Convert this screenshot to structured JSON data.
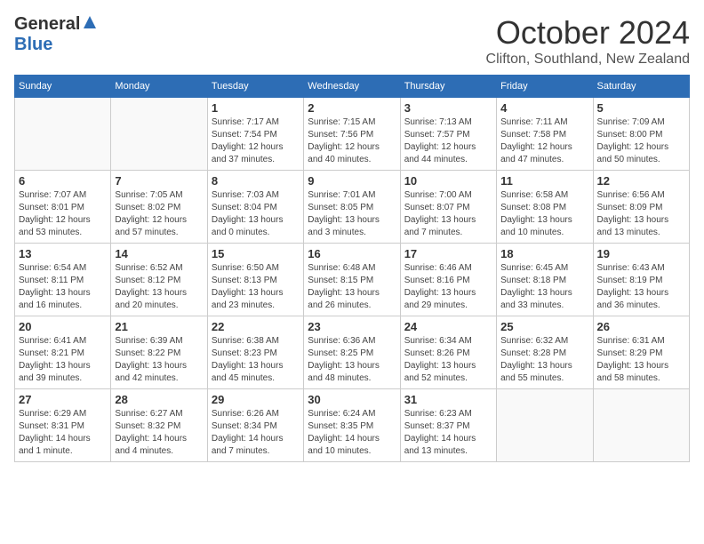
{
  "header": {
    "logo_general": "General",
    "logo_blue": "Blue",
    "month_title": "October 2024",
    "location": "Clifton, Southland, New Zealand"
  },
  "days_of_week": [
    "Sunday",
    "Monday",
    "Tuesday",
    "Wednesday",
    "Thursday",
    "Friday",
    "Saturday"
  ],
  "weeks": [
    [
      {
        "day": "",
        "info": ""
      },
      {
        "day": "",
        "info": ""
      },
      {
        "day": "1",
        "info": "Sunrise: 7:17 AM\nSunset: 7:54 PM\nDaylight: 12 hours and 37 minutes."
      },
      {
        "day": "2",
        "info": "Sunrise: 7:15 AM\nSunset: 7:56 PM\nDaylight: 12 hours and 40 minutes."
      },
      {
        "day": "3",
        "info": "Sunrise: 7:13 AM\nSunset: 7:57 PM\nDaylight: 12 hours and 44 minutes."
      },
      {
        "day": "4",
        "info": "Sunrise: 7:11 AM\nSunset: 7:58 PM\nDaylight: 12 hours and 47 minutes."
      },
      {
        "day": "5",
        "info": "Sunrise: 7:09 AM\nSunset: 8:00 PM\nDaylight: 12 hours and 50 minutes."
      }
    ],
    [
      {
        "day": "6",
        "info": "Sunrise: 7:07 AM\nSunset: 8:01 PM\nDaylight: 12 hours and 53 minutes."
      },
      {
        "day": "7",
        "info": "Sunrise: 7:05 AM\nSunset: 8:02 PM\nDaylight: 12 hours and 57 minutes."
      },
      {
        "day": "8",
        "info": "Sunrise: 7:03 AM\nSunset: 8:04 PM\nDaylight: 13 hours and 0 minutes."
      },
      {
        "day": "9",
        "info": "Sunrise: 7:01 AM\nSunset: 8:05 PM\nDaylight: 13 hours and 3 minutes."
      },
      {
        "day": "10",
        "info": "Sunrise: 7:00 AM\nSunset: 8:07 PM\nDaylight: 13 hours and 7 minutes."
      },
      {
        "day": "11",
        "info": "Sunrise: 6:58 AM\nSunset: 8:08 PM\nDaylight: 13 hours and 10 minutes."
      },
      {
        "day": "12",
        "info": "Sunrise: 6:56 AM\nSunset: 8:09 PM\nDaylight: 13 hours and 13 minutes."
      }
    ],
    [
      {
        "day": "13",
        "info": "Sunrise: 6:54 AM\nSunset: 8:11 PM\nDaylight: 13 hours and 16 minutes."
      },
      {
        "day": "14",
        "info": "Sunrise: 6:52 AM\nSunset: 8:12 PM\nDaylight: 13 hours and 20 minutes."
      },
      {
        "day": "15",
        "info": "Sunrise: 6:50 AM\nSunset: 8:13 PM\nDaylight: 13 hours and 23 minutes."
      },
      {
        "day": "16",
        "info": "Sunrise: 6:48 AM\nSunset: 8:15 PM\nDaylight: 13 hours and 26 minutes."
      },
      {
        "day": "17",
        "info": "Sunrise: 6:46 AM\nSunset: 8:16 PM\nDaylight: 13 hours and 29 minutes."
      },
      {
        "day": "18",
        "info": "Sunrise: 6:45 AM\nSunset: 8:18 PM\nDaylight: 13 hours and 33 minutes."
      },
      {
        "day": "19",
        "info": "Sunrise: 6:43 AM\nSunset: 8:19 PM\nDaylight: 13 hours and 36 minutes."
      }
    ],
    [
      {
        "day": "20",
        "info": "Sunrise: 6:41 AM\nSunset: 8:21 PM\nDaylight: 13 hours and 39 minutes."
      },
      {
        "day": "21",
        "info": "Sunrise: 6:39 AM\nSunset: 8:22 PM\nDaylight: 13 hours and 42 minutes."
      },
      {
        "day": "22",
        "info": "Sunrise: 6:38 AM\nSunset: 8:23 PM\nDaylight: 13 hours and 45 minutes."
      },
      {
        "day": "23",
        "info": "Sunrise: 6:36 AM\nSunset: 8:25 PM\nDaylight: 13 hours and 48 minutes."
      },
      {
        "day": "24",
        "info": "Sunrise: 6:34 AM\nSunset: 8:26 PM\nDaylight: 13 hours and 52 minutes."
      },
      {
        "day": "25",
        "info": "Sunrise: 6:32 AM\nSunset: 8:28 PM\nDaylight: 13 hours and 55 minutes."
      },
      {
        "day": "26",
        "info": "Sunrise: 6:31 AM\nSunset: 8:29 PM\nDaylight: 13 hours and 58 minutes."
      }
    ],
    [
      {
        "day": "27",
        "info": "Sunrise: 6:29 AM\nSunset: 8:31 PM\nDaylight: 14 hours and 1 minute."
      },
      {
        "day": "28",
        "info": "Sunrise: 6:27 AM\nSunset: 8:32 PM\nDaylight: 14 hours and 4 minutes."
      },
      {
        "day": "29",
        "info": "Sunrise: 6:26 AM\nSunset: 8:34 PM\nDaylight: 14 hours and 7 minutes."
      },
      {
        "day": "30",
        "info": "Sunrise: 6:24 AM\nSunset: 8:35 PM\nDaylight: 14 hours and 10 minutes."
      },
      {
        "day": "31",
        "info": "Sunrise: 6:23 AM\nSunset: 8:37 PM\nDaylight: 14 hours and 13 minutes."
      },
      {
        "day": "",
        "info": ""
      },
      {
        "day": "",
        "info": ""
      }
    ]
  ]
}
